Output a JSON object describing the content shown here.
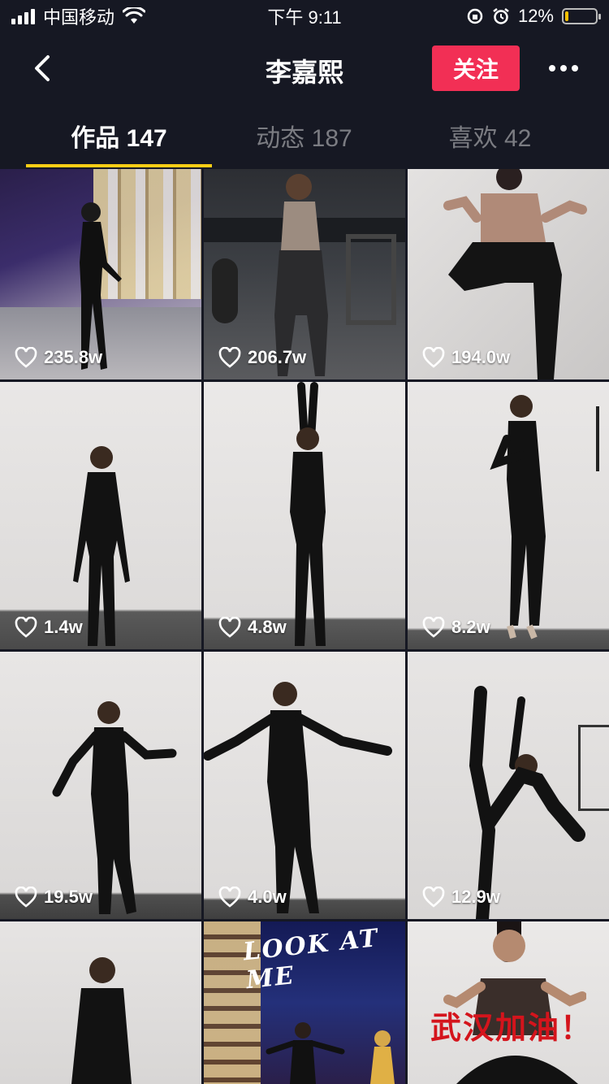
{
  "status_bar": {
    "carrier": "中国移动",
    "time": "下午 9:11",
    "battery": "12%",
    "battery_level": 0.12
  },
  "header": {
    "title": "李嘉熙",
    "follow_label": "关注"
  },
  "tabs": [
    {
      "label": "作品 147",
      "active": true
    },
    {
      "label": "动态 187",
      "active": false
    },
    {
      "label": "喜欢 42",
      "active": false
    }
  ],
  "videos": [
    {
      "likes": "235.8w"
    },
    {
      "likes": "206.7w"
    },
    {
      "likes": "194.0w"
    },
    {
      "likes": "1.4w"
    },
    {
      "likes": "4.8w"
    },
    {
      "likes": "8.2w"
    },
    {
      "likes": "19.5w"
    },
    {
      "likes": "4.0w"
    },
    {
      "likes": "12.9w"
    },
    {
      "likes": ""
    },
    {
      "likes": "",
      "overlay": "LOOK AT ME"
    },
    {
      "likes": "",
      "overlay": "武汉加油！"
    }
  ],
  "colors": {
    "background": "#161823",
    "follow": "#f22f55",
    "tab_indicator": "#face15"
  }
}
